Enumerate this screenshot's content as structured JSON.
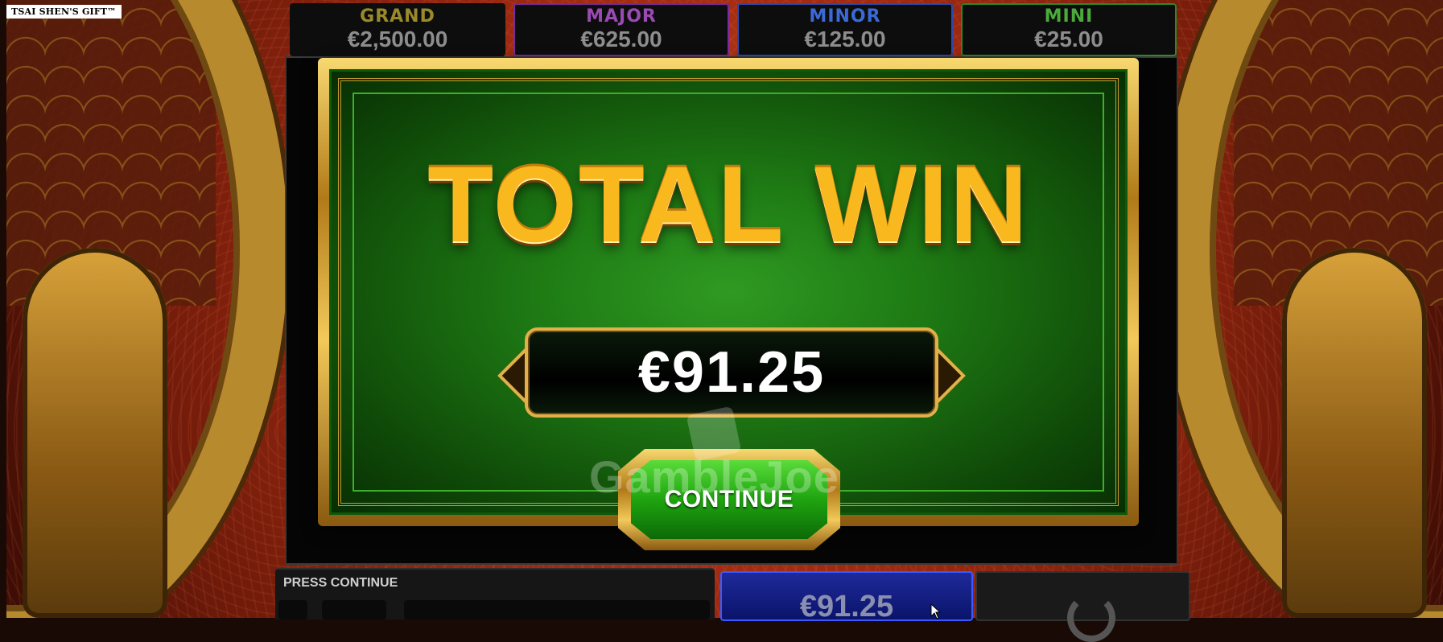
{
  "game": {
    "title": "TSAI SHEN'S GIFT™"
  },
  "jackpots": [
    {
      "label": "GRAND",
      "value": "€2,500.00",
      "color": "#9a8a2a"
    },
    {
      "label": "MAJOR",
      "value": "€625.00",
      "color": "#9a4ab2"
    },
    {
      "label": "MINOR",
      "value": "€125.00",
      "color": "#3a6ad8"
    },
    {
      "label": "MINI",
      "value": "€25.00",
      "color": "#4aaa3a"
    }
  ],
  "win_dialog": {
    "title": "TOTAL WIN",
    "amount": "€91.25",
    "continue_label": "CONTINUE"
  },
  "watermark": {
    "text": "GambleJoe"
  },
  "bottom_bar": {
    "status": "PRESS CONTINUE",
    "win_value": "€91.25"
  },
  "colors": {
    "panel_green": "#1e7a14",
    "gold": "#f8b81e",
    "background_red": "#9e2a12",
    "win_meter_blue": "#1e2a9a"
  }
}
